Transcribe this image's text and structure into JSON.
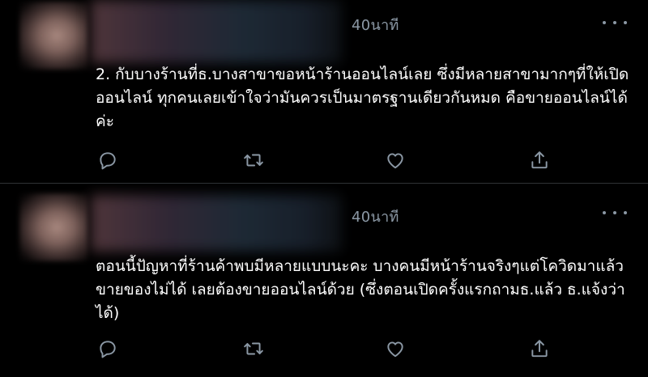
{
  "tweets": [
    {
      "time": "40นาที",
      "text": "2. กับบางร้านที่ธ.บางสาขาขอหน้าร้านออนไลน์เลย ซึ่งมีหลายสาขามากๆที่ให้เปิดออนไลน์ ทุกคนเลยเข้าใจว่ามันควรเป็นมาตรฐานเดียวกันหมด คือขายออนไลน์ได้ค่ะ"
    },
    {
      "time": "40นาที",
      "text": "ตอนนี้ปัญหาที่ร้านค้าพบมีหลายแบบนะคะ บางคนมีหน้าร้านจริงๆแต่โควิดมาแล้วขายของไม่ได้ เลยต้องขายออนไลน์ด้วย (ซึ่งตอนเปิดครั้งแรกถามธ.แล้ว ธ.แจ้งว่าได้)"
    }
  ],
  "icons": {
    "reply": "reply-icon",
    "retweet": "retweet-icon",
    "like": "like-icon",
    "share": "share-icon",
    "more": "more-icon"
  },
  "colors": {
    "background": "#000000",
    "text": "#ffffff",
    "secondary": "#8b98a5",
    "divider": "#2f3336"
  }
}
